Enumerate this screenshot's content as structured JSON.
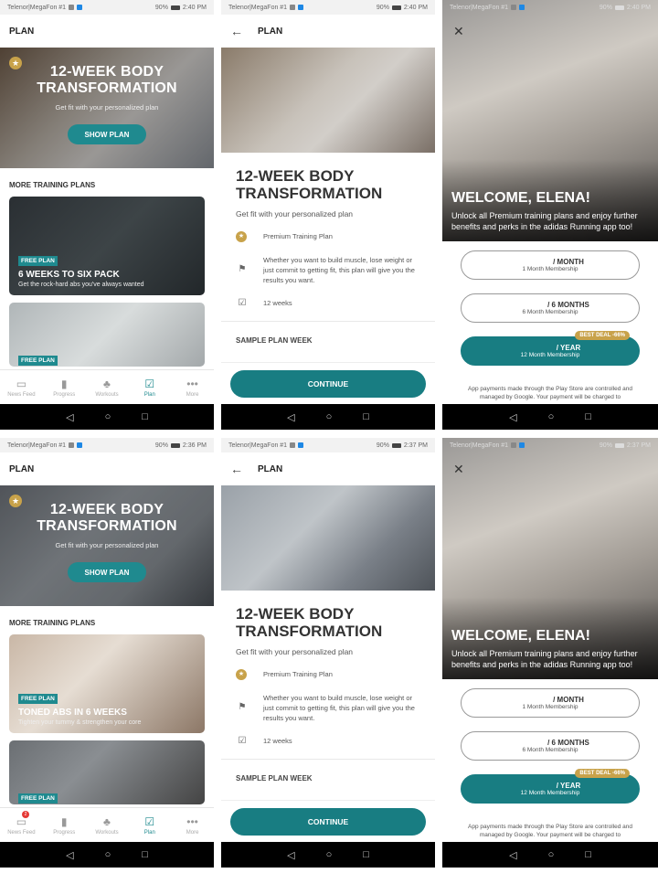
{
  "screens": {
    "s1": {
      "status": {
        "carrier": "Telenor|MegaFon #1",
        "battery": "90%",
        "time": "2:40 PM"
      },
      "appbar_title": "PLAN",
      "hero": {
        "title": "12-WEEK BODY TRANSFORMATION",
        "subtitle": "Get fit with your personalized plan",
        "button": "SHOW PLAN"
      },
      "section_title": "MORE TRAINING PLANS",
      "cards": [
        {
          "badge": "FREE PLAN",
          "title": "6 WEEKS TO SIX PACK",
          "subtitle": "Get the rock-hard abs you've always wanted"
        },
        {
          "badge": "FREE PLAN"
        }
      ]
    },
    "s2": {
      "status": {
        "carrier": "Telenor|MegaFon #1",
        "battery": "90%",
        "time": "2:40 PM"
      },
      "appbar_title": "PLAN",
      "title": "12-WEEK BODY TRANSFORMATION",
      "subtitle": "Get fit with your personalized plan",
      "features": [
        "Premium Training Plan",
        "Whether you want to build muscle, lose weight or just commit to getting fit, this plan will give you the results you want.",
        "12 weeks"
      ],
      "sample_title": "SAMPLE PLAN WEEK",
      "continue": "CONTINUE"
    },
    "s3": {
      "status": {
        "carrier": "Telenor|MegaFon #1",
        "battery": "90%",
        "time": "2:40 PM"
      },
      "welcome": "WELCOME, ELENA!",
      "description": "Unlock all Premium training plans and enjoy further benefits and perks in the adidas Running app too!",
      "plans": [
        {
          "period": "/ MONTH",
          "name": "1 Month Membership"
        },
        {
          "period": "/ 6 MONTHS",
          "name": "6 Month Membership"
        },
        {
          "period": "/ YEAR",
          "name": "12 Month Membership",
          "badge": "BEST DEAL -66%"
        }
      ],
      "disclaimer": "App payments made through the Play Store are controlled and managed by Google. Your payment will be charged to"
    },
    "s4": {
      "status": {
        "carrier": "Telenor|MegaFon #1",
        "battery": "90%",
        "time": "2:36 PM"
      },
      "appbar_title": "PLAN",
      "hero": {
        "title": "12-WEEK BODY TRANSFORMATION",
        "subtitle": "Get fit with your personalized plan",
        "button": "SHOW PLAN"
      },
      "section_title": "MORE TRAINING PLANS",
      "cards": [
        {
          "badge": "FREE PLAN",
          "title": "TONED ABS IN 6 WEEKS",
          "subtitle": "Tighten your tummy & strengthen your core"
        },
        {
          "badge": "FREE PLAN"
        }
      ],
      "news_badge": "2"
    },
    "s5": {
      "status": {
        "carrier": "Telenor|MegaFon #1",
        "battery": "90%",
        "time": "2:37 PM"
      },
      "appbar_title": "PLAN",
      "title": "12-WEEK BODY TRANSFORMATION",
      "subtitle": "Get fit with your personalized plan",
      "features": [
        "Premium Training Plan",
        "Whether you want to build muscle, lose weight or just commit to getting fit, this plan will give you the results you want.",
        "12 weeks"
      ],
      "sample_title": "SAMPLE PLAN WEEK",
      "continue": "CONTINUE"
    },
    "s6": {
      "status": {
        "carrier": "Telenor|MegaFon #1",
        "battery": "90%",
        "time": "2:37 PM"
      },
      "welcome": "WELCOME, ELENA!",
      "description": "Unlock all Premium training plans and enjoy further benefits and perks in the adidas Running app too!",
      "plans": [
        {
          "period": "/ MONTH",
          "name": "1 Month Membership"
        },
        {
          "period": "/ 6 MONTHS",
          "name": "6 Month Membership"
        },
        {
          "period": "/ YEAR",
          "name": "12 Month Membership",
          "badge": "BEST DEAL -66%"
        }
      ],
      "disclaimer": "App payments made through the Play Store are controlled and managed by Google. Your payment will be charged to"
    }
  },
  "tabs": [
    "News Feed",
    "Progress",
    "Workouts",
    "Plan",
    "More"
  ],
  "icons": {
    "star": "★",
    "back": "←",
    "close": "✕",
    "flag": "⚑",
    "checklist": "☑",
    "news_feed": "▭",
    "progress": "▮",
    "workouts": "♣",
    "plan": "☑",
    "more": "•••",
    "nav_back": "◁",
    "nav_home": "○",
    "nav_recent": "□"
  },
  "colors": {
    "accent": "#187d82",
    "gold": "#c8a24a"
  }
}
